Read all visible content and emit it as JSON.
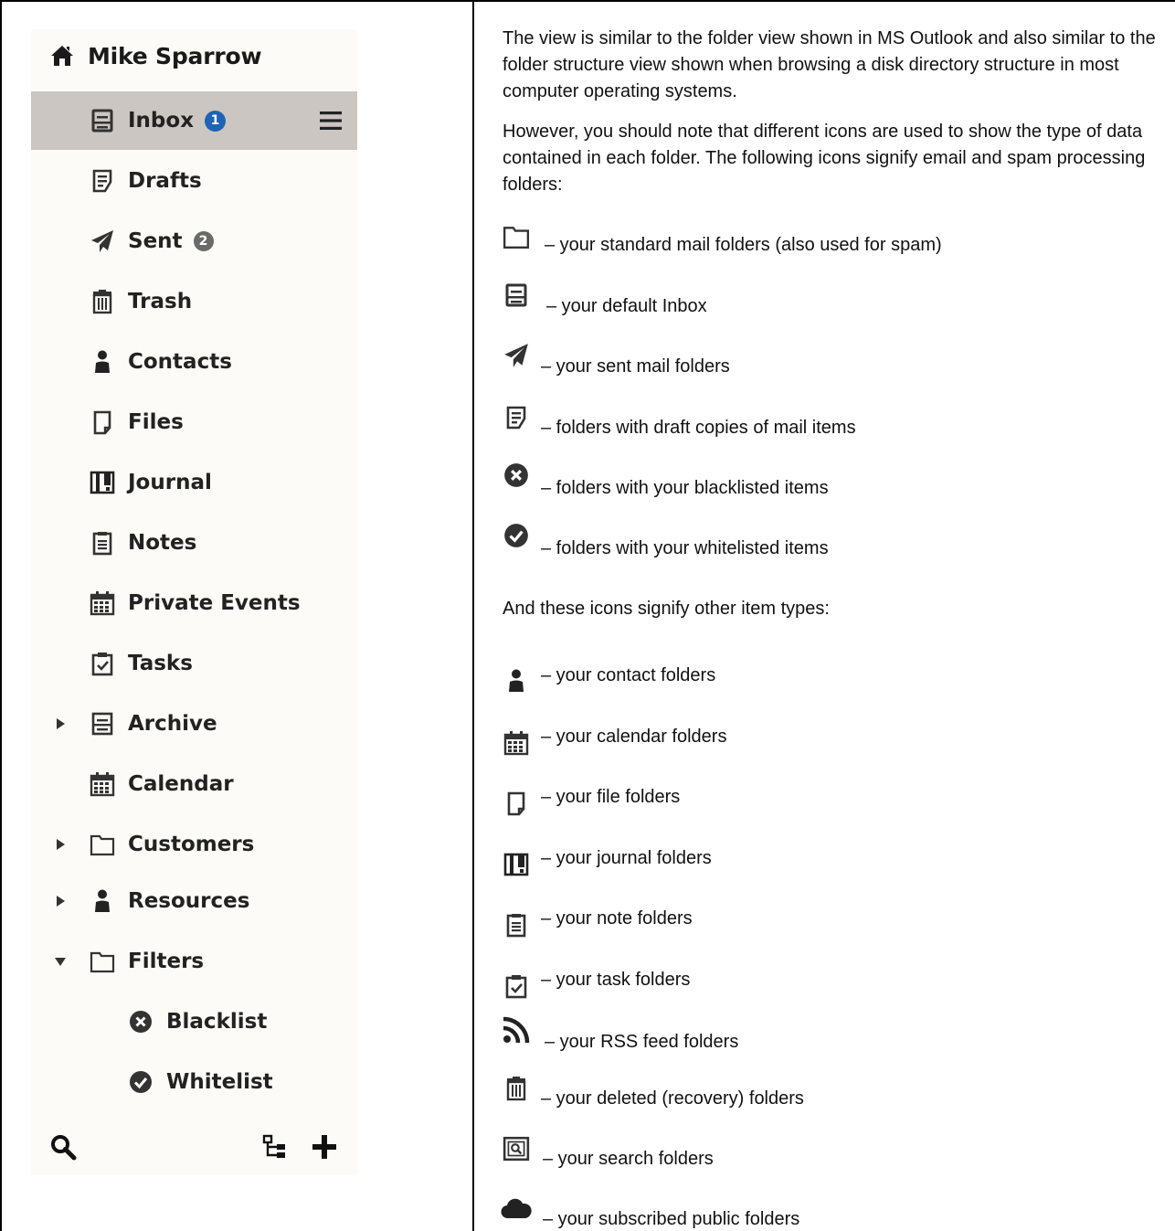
{
  "folder_panel": {
    "owner": {
      "icon": "home-icon",
      "name": "Mike Sparrow"
    },
    "folders": [
      {
        "label": "Inbox",
        "icon": "inbox-icon",
        "badge": "1",
        "badge_color": "#1e63b4",
        "active": true
      },
      {
        "label": "Drafts",
        "icon": "drafts-icon"
      },
      {
        "label": "Sent",
        "icon": "paper-plane-icon",
        "badge": "2",
        "badge_color": "#6a6a6a"
      },
      {
        "label": "Trash",
        "icon": "trash-icon"
      },
      {
        "label": "Contacts",
        "icon": "person-icon"
      },
      {
        "label": "Files",
        "icon": "file-icon"
      },
      {
        "label": "Journal",
        "icon": "journal-icon"
      },
      {
        "label": "Notes",
        "icon": "notes-icon"
      },
      {
        "label": "Private Events",
        "icon": "calendar-icon"
      },
      {
        "label": "Tasks",
        "icon": "task-icon"
      },
      {
        "label": "Archive",
        "icon": "archive-icon",
        "expander": "collapsed"
      },
      {
        "label": "Calendar",
        "icon": "calendar-icon"
      },
      {
        "label": "Customers",
        "icon": "folder-icon",
        "expander": "collapsed"
      },
      {
        "label": "Resources",
        "icon": "person-icon",
        "expander": "collapsed"
      },
      {
        "label": "Filters",
        "icon": "folder-icon",
        "expander": "expanded"
      },
      {
        "label": "Blacklist",
        "icon": "blacklist-icon",
        "indent": 1
      },
      {
        "label": "Whitelist",
        "icon": "whitelist-icon",
        "indent": 1
      }
    ],
    "footer": {
      "search_icon": "search-icon",
      "tree_icon": "folder-tree-icon",
      "add_icon": "plus-icon"
    },
    "menu_icon": "hamburger-menu-icon"
  },
  "description": {
    "intro": "The view is similar to the folder view shown in MS Outlook and also similar to the folder structure view shown when browsing a disk directory structure in most computer operating systems.",
    "note": "However, you should note that different icons are used to show the type of data contained in each folder. The following icons signify email and spam processing folders:",
    "other_heading": "And these icons signify other item types:",
    "email_icons": [
      {
        "icon": "folder-icon",
        "text": "– your standard mail folders (also used for spam)"
      },
      {
        "icon": "inbox-icon",
        "text": "– your default Inbox"
      },
      {
        "icon": "paper-plane-icon",
        "text": "– your sent mail folders"
      },
      {
        "icon": "drafts-icon",
        "text": "– folders with draft copies of mail items"
      },
      {
        "icon": "blacklist-icon",
        "text": "– folders with your blacklisted items"
      },
      {
        "icon": "whitelist-icon",
        "text": "– folders with your whitelisted items"
      }
    ],
    "other_icons": [
      {
        "icon": "person-icon",
        "text": "– your contact folders"
      },
      {
        "icon": "calendar-icon",
        "text": "– your calendar folders"
      },
      {
        "icon": "file-icon",
        "text": "– your file folders"
      },
      {
        "icon": "journal-icon",
        "text": "– your journal folders"
      },
      {
        "icon": "notes-icon",
        "text": "– your note folders"
      },
      {
        "icon": "task-icon",
        "text": "– your task folders"
      },
      {
        "icon": "rss-icon",
        "text": "– your RSS feed folders"
      },
      {
        "icon": "trash-icon",
        "text": "– your deleted (recovery) folders"
      },
      {
        "icon": "search-folder-icon",
        "text": "– your search folders"
      },
      {
        "icon": "cloud-icon",
        "text": "– your subscribed public folders"
      }
    ]
  }
}
